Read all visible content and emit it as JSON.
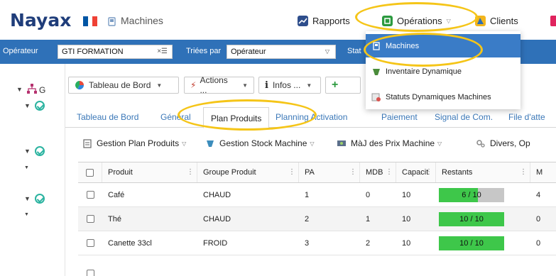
{
  "header": {
    "logo": "Nayax",
    "breadcrumb": "Machines",
    "nav": {
      "rapports": "Rapports",
      "operations": "Opérations",
      "clients": "Clients"
    }
  },
  "dropdown": {
    "items": [
      {
        "label": "Machines"
      },
      {
        "label": "Inventaire Dynamique"
      },
      {
        "label": "Statuts Dynamiques Machines"
      }
    ]
  },
  "filterbar": {
    "operateur_label": "Opérateur",
    "operateur_value": "GTI FORMATION",
    "clear_symbol": "×☰",
    "triees_label": "Triées par",
    "triees_value": "Opérateur",
    "truncated_label": "Stat"
  },
  "tree": {
    "root_label": "G"
  },
  "toolbar": {
    "tableau": "Tableau de Bord",
    "actions": "Actions ...",
    "infos": "Infos ...",
    "plus": "+"
  },
  "tabs": [
    {
      "label": "Tableau de Bord"
    },
    {
      "label": "Général"
    },
    {
      "label": "Plan Produits"
    },
    {
      "label": "Planning Activation"
    },
    {
      "label": "Paiement"
    },
    {
      "label": "Signal de Com."
    },
    {
      "label": "File d'atte"
    }
  ],
  "subtoolbar": {
    "gestion_plan": "Gestion Plan Produits",
    "gestion_stock": "Gestion Stock Machine",
    "maj_prix": "MàJ des Prix Machine",
    "divers": "Divers, Op"
  },
  "grid": {
    "columns": [
      "Produit",
      "Groupe Produit",
      "PA",
      "MDB",
      "Capacit",
      "Restants",
      "M"
    ],
    "rows": [
      {
        "produit": "Café",
        "groupe": "CHAUD",
        "pa": "1",
        "mdb": "0",
        "capacite": "10",
        "restants_text": "6 / 10",
        "restants_fraction": 0.6,
        "m": "4"
      },
      {
        "produit": "Thé",
        "groupe": "CHAUD",
        "pa": "2",
        "mdb": "1",
        "capacite": "10",
        "restants_text": "10 / 10",
        "restants_fraction": 1.0,
        "m": "0"
      },
      {
        "produit": "Canette 33cl",
        "groupe": "FROID",
        "pa": "3",
        "mdb": "2",
        "capacite": "10",
        "restants_text": "10 / 10",
        "restants_fraction": 1.0,
        "m": "0"
      }
    ]
  },
  "colors": {
    "brand_blue": "#2f71b8",
    "logo_navy": "#1f3d7a",
    "highlight_yellow": "#f5c518",
    "bar_green": "#3ec74a",
    "bar_grey": "#c7c7c7",
    "tab_link": "#3b78b8"
  },
  "icons": {
    "breadcrumb": "machine-icon",
    "rapports": "chart-icon",
    "operations": "operations-icon",
    "clients": "clients-icon",
    "tableau": "pie-chart-icon",
    "actions": "lightning-icon",
    "infos": "info-icon",
    "gestion_plan": "clipboard-icon",
    "gestion_stock": "stock-icon",
    "maj_prix": "price-update-icon",
    "divers": "gears-icon"
  }
}
